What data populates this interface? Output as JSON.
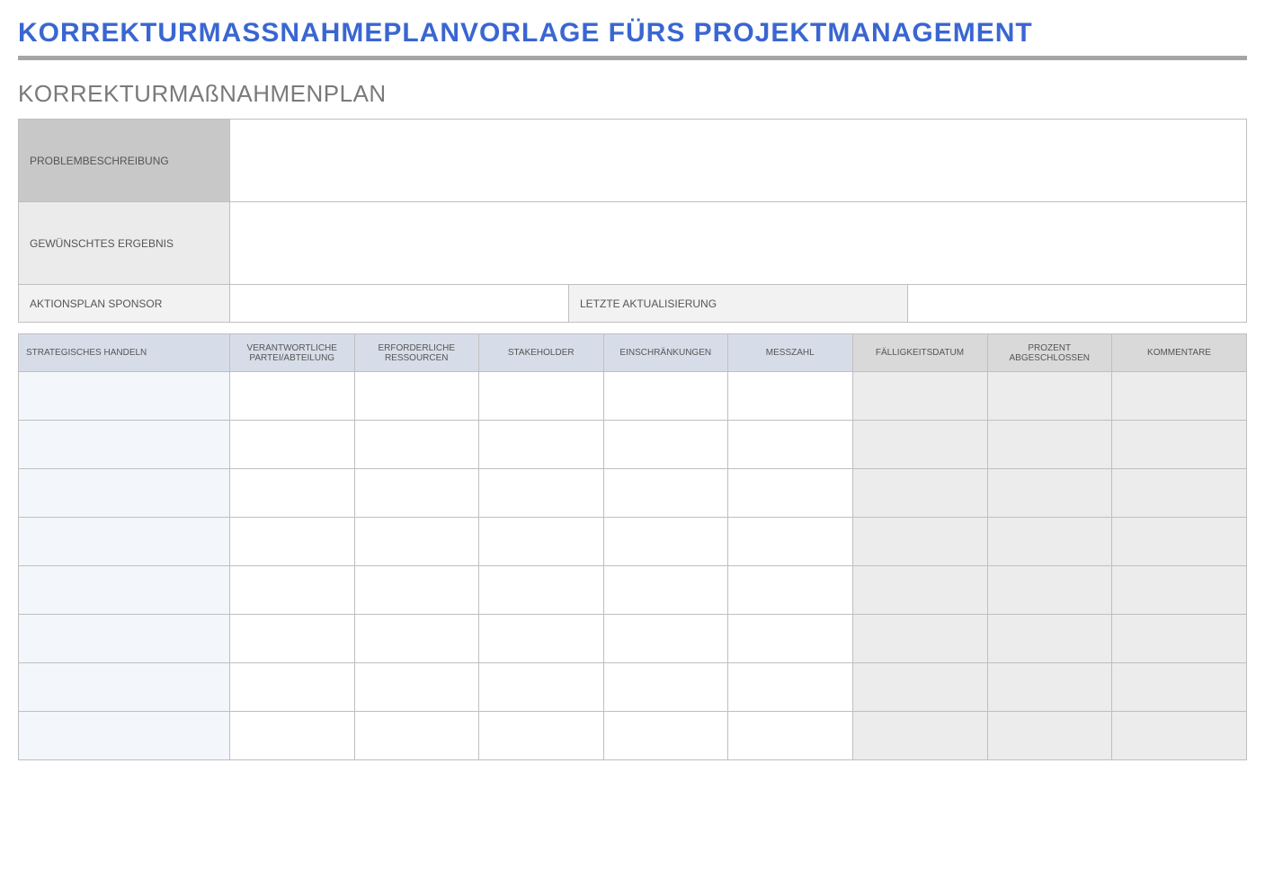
{
  "page_title": "KORREKTURMASSNAHMEPLANVORLAGE FÜRS PROJEKTMANAGEMENT",
  "section_title": "KORREKTURMAßNAHMENPLAN",
  "summary": {
    "problem_label": "PROBLEMBESCHREIBUNG",
    "problem_value": "",
    "outcome_label": "GEWÜNSCHTES ERGEBNIS",
    "outcome_value": "",
    "sponsor_label": "AKTIONSPLAN SPONSOR",
    "sponsor_value": "",
    "updated_label": "LETZTE AKTUALISIERUNG",
    "updated_value": ""
  },
  "action": {
    "headers": {
      "strategic": "STRATEGISCHES HANDELN",
      "responsible": "VERANTWORTLICHE PARTEI/ABTEILUNG",
      "resources": "ERFORDERLICHE RESSOURCEN",
      "stakeholder": "STAKEHOLDER",
      "constraints": "EINSCHRÄNKUNGEN",
      "metric": "MESSZAHL",
      "due": "FÄLLIGKEITSDATUM",
      "percent": "PROZENT ABGESCHLOSSEN",
      "comments": "KOMMENTARE"
    },
    "rows": [
      {
        "strategic": "",
        "responsible": "",
        "resources": "",
        "stakeholder": "",
        "constraints": "",
        "metric": "",
        "due": "",
        "percent": "",
        "comments": ""
      },
      {
        "strategic": "",
        "responsible": "",
        "resources": "",
        "stakeholder": "",
        "constraints": "",
        "metric": "",
        "due": "",
        "percent": "",
        "comments": ""
      },
      {
        "strategic": "",
        "responsible": "",
        "resources": "",
        "stakeholder": "",
        "constraints": "",
        "metric": "",
        "due": "",
        "percent": "",
        "comments": ""
      },
      {
        "strategic": "",
        "responsible": "",
        "resources": "",
        "stakeholder": "",
        "constraints": "",
        "metric": "",
        "due": "",
        "percent": "",
        "comments": ""
      },
      {
        "strategic": "",
        "responsible": "",
        "resources": "",
        "stakeholder": "",
        "constraints": "",
        "metric": "",
        "due": "",
        "percent": "",
        "comments": ""
      },
      {
        "strategic": "",
        "responsible": "",
        "resources": "",
        "stakeholder": "",
        "constraints": "",
        "metric": "",
        "due": "",
        "percent": "",
        "comments": ""
      },
      {
        "strategic": "",
        "responsible": "",
        "resources": "",
        "stakeholder": "",
        "constraints": "",
        "metric": "",
        "due": "",
        "percent": "",
        "comments": ""
      },
      {
        "strategic": "",
        "responsible": "",
        "resources": "",
        "stakeholder": "",
        "constraints": "",
        "metric": "",
        "due": "",
        "percent": "",
        "comments": ""
      }
    ]
  }
}
